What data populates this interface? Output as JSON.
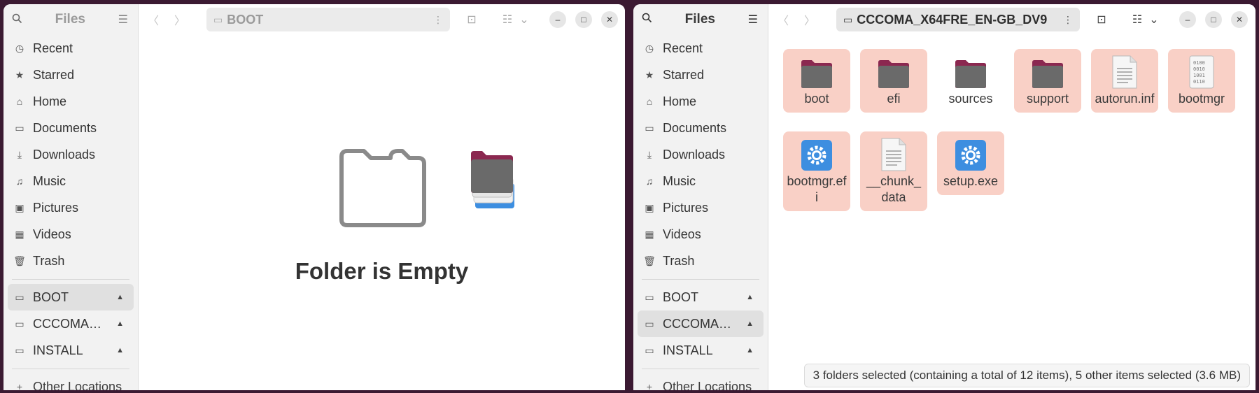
{
  "left": {
    "sidebar": {
      "title": "Files",
      "places": [
        "Recent",
        "Starred",
        "Home",
        "Documents",
        "Downloads",
        "Music",
        "Pictures",
        "Videos",
        "Trash"
      ],
      "devices": [
        "BOOT",
        "CCCOMA…",
        "INSTALL"
      ],
      "other": "Other Locations"
    },
    "path": "BOOT",
    "empty_message": "Folder is Empty"
  },
  "right": {
    "sidebar": {
      "title": "Files",
      "places": [
        "Recent",
        "Starred",
        "Home",
        "Documents",
        "Downloads",
        "Music",
        "Pictures",
        "Videos",
        "Trash"
      ],
      "devices": [
        "BOOT",
        "CCCOMA…",
        "INSTALL"
      ],
      "other": "Other Locations"
    },
    "path": "CCCOMA_X64FRE_EN-GB_DV9",
    "files": [
      {
        "name": "boot",
        "kind": "folder",
        "selected": true
      },
      {
        "name": "efi",
        "kind": "folder",
        "selected": true
      },
      {
        "name": "sources",
        "kind": "folder",
        "selected": false
      },
      {
        "name": "support",
        "kind": "folder",
        "selected": true
      },
      {
        "name": "autorun.inf",
        "kind": "text",
        "selected": true
      },
      {
        "name": "bootmgr",
        "kind": "binary",
        "selected": true
      },
      {
        "name": "bootmgr.efi",
        "kind": "exec",
        "selected": true
      },
      {
        "name": "__chunk_data",
        "kind": "text",
        "selected": true
      },
      {
        "name": "setup.exe",
        "kind": "exec",
        "selected": true
      }
    ],
    "status": "3 folders selected (containing a total of 12 items), 5 other items selected (3.6 MB)"
  },
  "colors": {
    "selection": "#f9d0c6",
    "folder": "#6a6a6a",
    "folder_tab": "#8b2850",
    "exec_blue": "#3d8ee0"
  }
}
